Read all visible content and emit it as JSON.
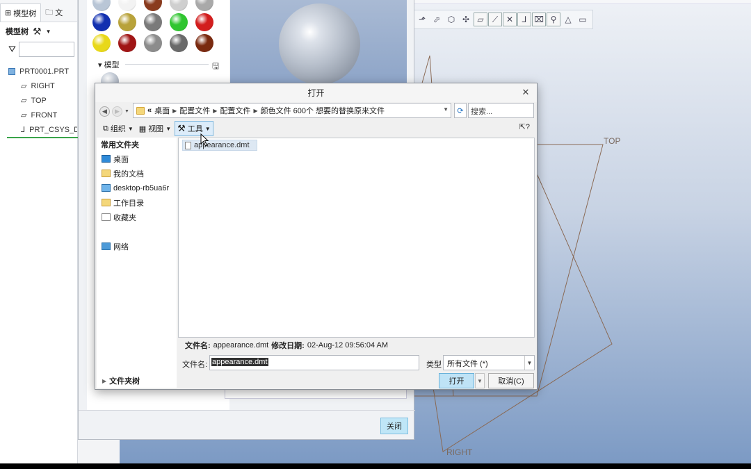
{
  "left_panel": {
    "tab_model_tree": "模型树",
    "tab_folder": "文",
    "toolbar_label": "模型树",
    "tree": {
      "root": "PRT0001.PRT",
      "children": [
        "RIGHT",
        "TOP",
        "FRONT",
        "PRT_CSYS_DEF"
      ]
    }
  },
  "gallery": {
    "section_model": "模型",
    "close_label": "关闭",
    "swatch_colors": [
      [
        "#b9c6d6",
        "#f3f3f3",
        "#8a3b1e",
        "#cfcfcf",
        "#a9a9a9"
      ],
      [
        "#1230b0",
        "#b8a23a",
        "#7a7a7a",
        "#30c530",
        "#d21e1e"
      ],
      [
        "#e8d81a",
        "#a01515",
        "#8c8c8c",
        "#6a6a6a",
        "#7a2a10"
      ]
    ]
  },
  "graphics": {
    "label_top": "TOP",
    "label_right": "RIGHT"
  },
  "dialog": {
    "title": "打开",
    "breadcrumb": [
      "桌面",
      "配置文件",
      "配置文件",
      "颜色文件 600个 想要的替换原来文件"
    ],
    "search_placeholder": "搜索...",
    "commands": {
      "organize": "组织",
      "view": "视图",
      "tools": "工具"
    },
    "nav": {
      "favorites_header": "常用文件夹",
      "items": [
        "桌面",
        "我的文档",
        "desktop-rb5ua6r",
        "工作目录",
        "收藏夹"
      ],
      "network": "网络",
      "folder_tree": "文件夹树"
    },
    "files": [
      "appearance.dmt"
    ],
    "info": {
      "name_label": "文件名:",
      "name_value": "appearance.dmt",
      "date_label": "修改日期:",
      "date_value": "02-Aug-12 09:56:04 AM"
    },
    "filename_label": "文件名:",
    "filename_value": "appearance.dmt",
    "type_label": "类型",
    "type_value": "所有文件 (*)",
    "open_button": "打开",
    "cancel_button": "取消(C)"
  }
}
